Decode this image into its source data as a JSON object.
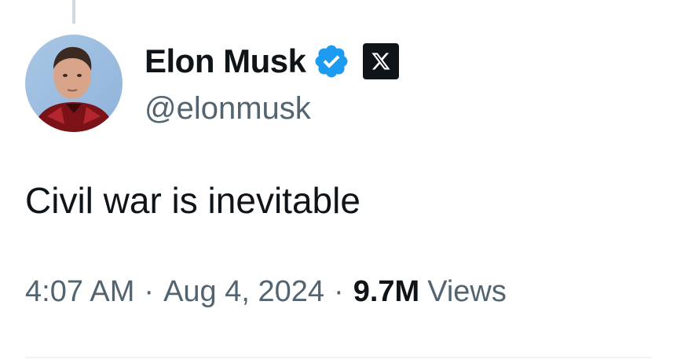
{
  "tweet": {
    "author": {
      "display_name": "Elon Musk",
      "handle": "@elonmusk",
      "avatar_icon": "avatar-photo",
      "verified_icon": "verified-badge-icon",
      "verified_color": "#1d9bf0",
      "affiliate_icon": "x-logo-icon"
    },
    "text": "Civil war is inevitable",
    "time": "4:07 AM",
    "separator": "·",
    "date": "Aug 4, 2024",
    "views_count": "9.7M",
    "views_label": "Views"
  },
  "colors": {
    "text_primary": "#0f1419",
    "text_secondary": "#536471",
    "verified_blue": "#1d9bf0",
    "divider": "#eff3f4"
  }
}
